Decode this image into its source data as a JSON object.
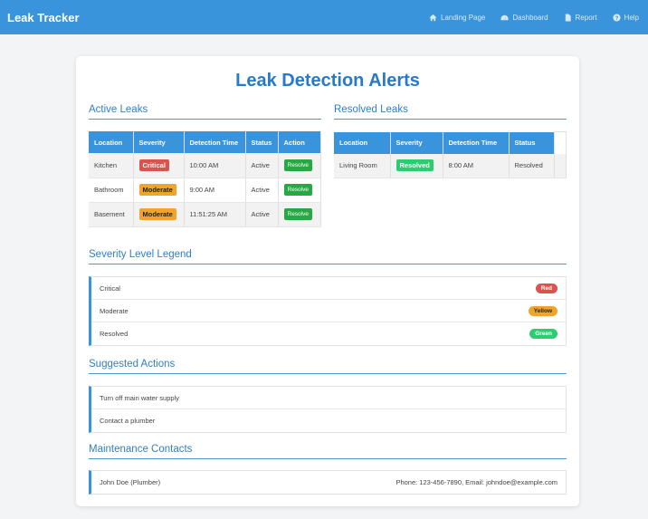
{
  "nav": {
    "brand": "Leak Tracker",
    "items": [
      {
        "label": "Landing Page",
        "icon": "home-icon"
      },
      {
        "label": "Dashboard",
        "icon": "dashboard-icon"
      },
      {
        "label": "Report",
        "icon": "file-icon"
      },
      {
        "label": "Help",
        "icon": "help-icon"
      }
    ]
  },
  "title": "Leak Detection Alerts",
  "active": {
    "heading": "Active Leaks",
    "headers": [
      "Location",
      "Severity",
      "Detection Time",
      "Status",
      "Action"
    ],
    "rows": [
      {
        "location": "Kitchen",
        "severity": "Critical",
        "time": "10:00 AM",
        "status": "Active",
        "action": "Resolve"
      },
      {
        "location": "Bathroom",
        "severity": "Moderate",
        "time": "9:00 AM",
        "status": "Active",
        "action": "Resolve"
      },
      {
        "location": "Basement",
        "severity": "Moderate",
        "time": "11:51:25 AM",
        "status": "Active",
        "action": "Resolve"
      }
    ]
  },
  "resolved": {
    "heading": "Resolved Leaks",
    "headers": [
      "Location",
      "Severity",
      "Detection Time",
      "Status"
    ],
    "rows": [
      {
        "location": "Living Room",
        "severity": "Resolved",
        "time": "8:00 AM",
        "status": "Resolved"
      }
    ]
  },
  "legend": {
    "heading": "Severity Level Legend",
    "items": [
      {
        "label": "Critical",
        "color": "Red"
      },
      {
        "label": "Moderate",
        "color": "Yellow"
      },
      {
        "label": "Resolved",
        "color": "Green"
      }
    ]
  },
  "actions": {
    "heading": "Suggested Actions",
    "items": [
      "Turn off main water supply",
      "Contact a plumber"
    ]
  },
  "contacts": {
    "heading": "Maintenance Contacts",
    "items": [
      {
        "name": "John Doe (Plumber)",
        "info": "Phone: 123-456-7890, Email: johndoe@example.com"
      }
    ]
  },
  "colors": {
    "primary": "#3a94dc",
    "critical": "#d9534f",
    "moderate": "#f0a52a",
    "resolved": "#2ecc71",
    "resolve_button": "#28a745"
  }
}
